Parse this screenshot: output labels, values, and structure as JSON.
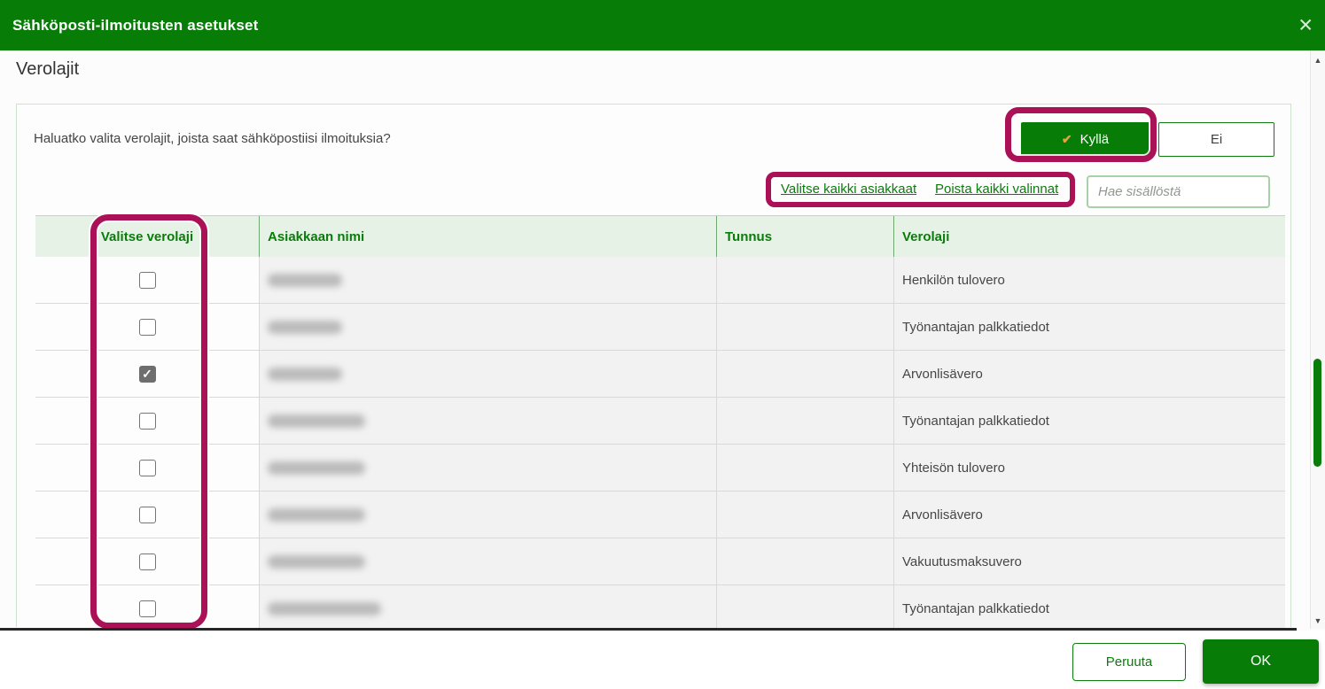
{
  "dialog": {
    "title": "Sähköposti-ilmoitusten asetukset",
    "close_icon": "✕"
  },
  "page": {
    "heading": "Verolajit"
  },
  "panel": {
    "question": "Haluatko valita verolajit, joista saat sähköpostiisi ilmoituksia?",
    "yes_label": "Kyllä",
    "yes_check_icon": "✔",
    "no_label": "Ei",
    "select_all_link": "Valitse kaikki asiakkaat",
    "clear_all_link": "Poista kaikki valinnat",
    "search_placeholder": "Hae sisällöstä",
    "search_value": ""
  },
  "table": {
    "columns": [
      "Valitse verolaji",
      "Asiakkaan nimi",
      "Tunnus",
      "Verolaji"
    ],
    "rows": [
      {
        "checked": false,
        "name_redacted": true,
        "name_blur_width": 84,
        "tunnus": "",
        "verolaji": "Henkilön tulovero"
      },
      {
        "checked": false,
        "name_redacted": true,
        "name_blur_width": 84,
        "tunnus": "",
        "verolaji": "Työnantajan palkkatiedot"
      },
      {
        "checked": true,
        "name_redacted": true,
        "name_blur_width": 84,
        "tunnus": "",
        "verolaji": "Arvonlisävero"
      },
      {
        "checked": false,
        "name_redacted": true,
        "name_blur_width": 110,
        "tunnus": "",
        "verolaji": "Työnantajan palkkatiedot"
      },
      {
        "checked": false,
        "name_redacted": true,
        "name_blur_width": 110,
        "tunnus": "",
        "verolaji": "Yhteisön tulovero"
      },
      {
        "checked": false,
        "name_redacted": true,
        "name_blur_width": 110,
        "tunnus": "",
        "verolaji": "Arvonlisävero"
      },
      {
        "checked": false,
        "name_redacted": true,
        "name_blur_width": 110,
        "tunnus": "",
        "verolaji": "Vakuutusmaksuvero"
      },
      {
        "checked": false,
        "name_redacted": true,
        "name_blur_width": 128,
        "tunnus": "",
        "verolaji": "Työnantajan palkkatiedot"
      }
    ],
    "checkbox_check_icon": "✓"
  },
  "footer": {
    "cancel_label": "Peruuta",
    "ok_label": "OK"
  },
  "scrollbar": {
    "up_icon": "▲",
    "down_icon": "▼"
  },
  "annotations": [
    {
      "target": "yes-button"
    },
    {
      "target": "select-links"
    },
    {
      "target": "checkbox-column"
    }
  ],
  "colors": {
    "brand_green": "#077d07",
    "link_green": "#0b7c0b",
    "header_row_green": "#e6f2e6",
    "row_gray": "#f2f2f2",
    "annotation_magenta": "#ab1157",
    "yes_check_orange": "#eba23c",
    "checked_checkbox_gray": "#6e6e6e",
    "divider_dark": "#262626"
  }
}
